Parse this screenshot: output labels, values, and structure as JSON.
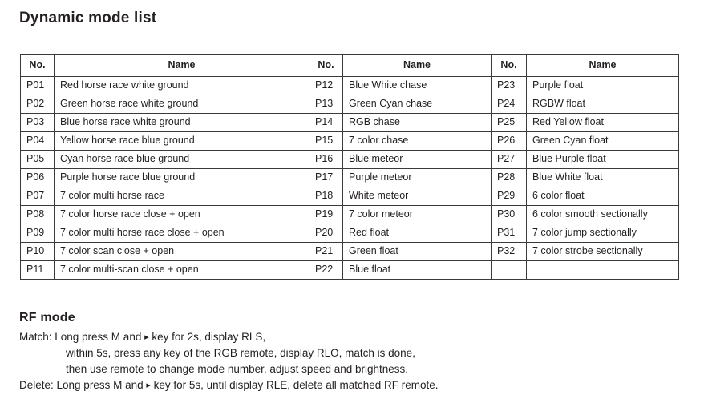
{
  "page_title": "Dynamic mode list",
  "table": {
    "headers": {
      "no": "No.",
      "name": "Name"
    },
    "groups": [
      {
        "rows": [
          {
            "no": "P01",
            "name": "Red horse race white ground"
          },
          {
            "no": "P02",
            "name": "Green horse race white ground"
          },
          {
            "no": "P03",
            "name": "Blue horse race white ground"
          },
          {
            "no": "P04",
            "name": "Yellow horse race blue ground"
          },
          {
            "no": "P05",
            "name": "Cyan horse race blue ground"
          },
          {
            "no": "P06",
            "name": "Purple horse race blue ground"
          },
          {
            "no": "P07",
            "name": "7 color multi horse race"
          },
          {
            "no": "P08",
            "name": "7 color horse race close + open"
          },
          {
            "no": "P09",
            "name": "7 color multi horse race close + open"
          },
          {
            "no": "P10",
            "name": "7 color scan close + open"
          },
          {
            "no": "P11",
            "name": "7 color multi-scan close + open"
          }
        ]
      },
      {
        "rows": [
          {
            "no": "P12",
            "name": "Blue White chase"
          },
          {
            "no": "P13",
            "name": "Green Cyan chase"
          },
          {
            "no": "P14",
            "name": "RGB chase"
          },
          {
            "no": "P15",
            "name": "7 color chase"
          },
          {
            "no": "P16",
            "name": "Blue meteor"
          },
          {
            "no": "P17",
            "name": "Purple meteor"
          },
          {
            "no": "P18",
            "name": "White meteor"
          },
          {
            "no": "P19",
            "name": "7 color meteor"
          },
          {
            "no": "P20",
            "name": "Red float"
          },
          {
            "no": "P21",
            "name": "Green float"
          },
          {
            "no": "P22",
            "name": "Blue float"
          }
        ]
      },
      {
        "rows": [
          {
            "no": "P23",
            "name": "Purple float"
          },
          {
            "no": "P24",
            "name": "RGBW float"
          },
          {
            "no": "P25",
            "name": "Red Yellow float"
          },
          {
            "no": "P26",
            "name": "Green Cyan float"
          },
          {
            "no": "P27",
            "name": "Blue Purple float"
          },
          {
            "no": "P28",
            "name": "Blue White float"
          },
          {
            "no": "P29",
            "name": "6 color float"
          },
          {
            "no": "P30",
            "name": "6 color smooth sectionally"
          },
          {
            "no": "P31",
            "name": "7 color jump sectionally"
          },
          {
            "no": "P32",
            "name": "7 color strobe sectionally"
          },
          {
            "no": "",
            "name": ""
          }
        ]
      }
    ]
  },
  "rf_mode": {
    "heading": "RF mode",
    "lines": [
      {
        "text_before": "Match: Long press M and ",
        "arrow": "▸",
        "text_after": " key for 2s, display RLS,",
        "indent": false
      },
      {
        "text_before": "within 5s, press any key of the RGB remote, display RLO, match is done,",
        "arrow": "",
        "text_after": "",
        "indent": true
      },
      {
        "text_before": "then use remote to change mode number, adjust speed and brightness.",
        "arrow": "",
        "text_after": "",
        "indent": true
      },
      {
        "text_before": "Delete: Long press M and ",
        "arrow": "▸",
        "text_after": " key for 5s, until display RLE, delete all matched RF remote.",
        "indent": false
      }
    ]
  },
  "colors": {
    "text": "#231f20",
    "border": "#3a3a3a",
    "background": "#ffffff"
  }
}
